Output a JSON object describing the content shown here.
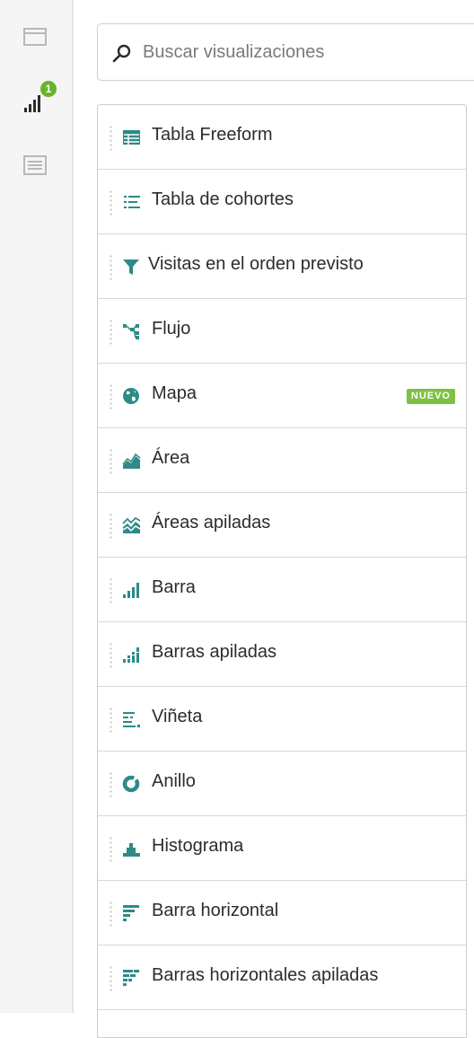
{
  "sidebar": {
    "items": [
      {
        "icon": "panel-icon"
      },
      {
        "icon": "visualizations-icon",
        "badge": "1"
      },
      {
        "icon": "components-icon"
      }
    ]
  },
  "search": {
    "placeholder": "Buscar visualizaciones",
    "value": ""
  },
  "visualizations": [
    {
      "label": "Tabla Freeform",
      "icon": "table-icon"
    },
    {
      "label": "Tabla de cohortes",
      "icon": "cohort-table-icon"
    },
    {
      "label": "Visitas en el orden previsto",
      "icon": "funnel-icon"
    },
    {
      "label": "Flujo",
      "icon": "flow-icon"
    },
    {
      "label": "Mapa",
      "icon": "globe-icon",
      "badge": "NUEVO"
    },
    {
      "label": "Área",
      "icon": "area-chart-icon"
    },
    {
      "label": "Áreas apiladas",
      "icon": "stacked-area-icon"
    },
    {
      "label": "Barra",
      "icon": "bar-chart-icon"
    },
    {
      "label": "Barras apiladas",
      "icon": "stacked-bar-icon"
    },
    {
      "label": "Viñeta",
      "icon": "bullet-chart-icon"
    },
    {
      "label": "Anillo",
      "icon": "donut-icon"
    },
    {
      "label": "Histograma",
      "icon": "histogram-icon"
    },
    {
      "label": "Barra horizontal",
      "icon": "horizontal-bar-icon"
    },
    {
      "label": "Barras horizontales apiladas",
      "icon": "stacked-horizontal-bar-icon"
    }
  ],
  "colors": {
    "accent": "#2d8a87",
    "badge_green": "#68b32c",
    "new_badge": "#7dc142"
  }
}
